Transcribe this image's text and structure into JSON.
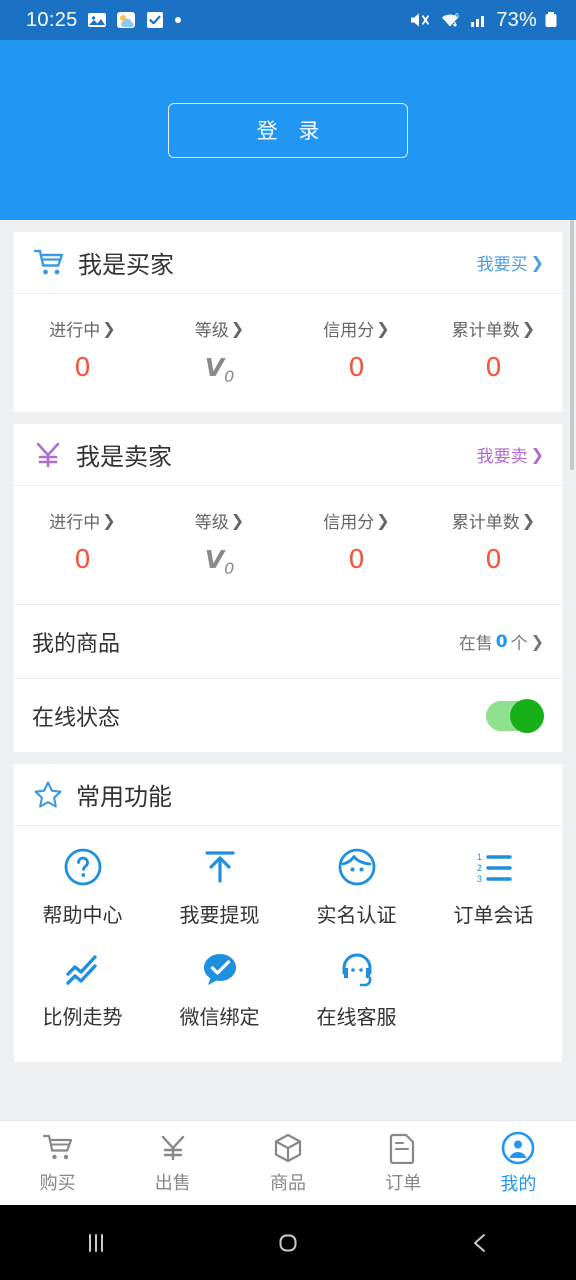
{
  "status_bar": {
    "time": "10:25",
    "left_icons": [
      "gallery-icon",
      "weather-icon",
      "task-icon",
      "dot-icon"
    ],
    "right_icons": [
      "mute-icon",
      "wifi-icon",
      "signal-icon"
    ],
    "battery": "73%",
    "background_color": "#1b72c4"
  },
  "header": {
    "login_label": "登 录",
    "background_color": "#2196f3"
  },
  "buyer_card": {
    "icon": "shopping-cart-icon",
    "title": "我是买家",
    "action_label": "我要买",
    "action_color": "#4a9fe0",
    "stats": [
      {
        "label": "进行中",
        "value": "0"
      },
      {
        "label": "等级",
        "value": "V0",
        "is_level": true
      },
      {
        "label": "信用分",
        "value": "0"
      },
      {
        "label": "累计单数",
        "value": "0"
      }
    ]
  },
  "seller_card": {
    "icon": "yen-icon",
    "title": "我是卖家",
    "action_label": "我要卖",
    "action_color": "#b06cd0",
    "stats": [
      {
        "label": "进行中",
        "value": "0"
      },
      {
        "label": "等级",
        "value": "V0",
        "is_level": true
      },
      {
        "label": "信用分",
        "value": "0"
      },
      {
        "label": "累计单数",
        "value": "0"
      }
    ],
    "goods_row": {
      "label": "我的商品",
      "value_prefix": "在售",
      "value_count": "0",
      "value_suffix": "个"
    },
    "online_row": {
      "label": "在线状态",
      "toggle_on": true,
      "toggle_color": "#18b018"
    }
  },
  "functions_card": {
    "icon": "star-icon",
    "title": "常用功能",
    "items": [
      {
        "icon": "question-circle-icon",
        "label": "帮助中心"
      },
      {
        "icon": "withdraw-arrow-icon",
        "label": "我要提现"
      },
      {
        "icon": "face-verify-icon",
        "label": "实名认证"
      },
      {
        "icon": "ordered-list-icon",
        "label": "订单会话"
      },
      {
        "icon": "trend-chart-icon",
        "label": "比例走势"
      },
      {
        "icon": "wechat-bind-icon",
        "label": "微信绑定"
      },
      {
        "icon": "headset-support-icon",
        "label": "在线客服"
      }
    ]
  },
  "tab_bar": {
    "items": [
      {
        "icon": "cart-icon",
        "label": "购买",
        "active": false
      },
      {
        "icon": "yen-icon",
        "label": "出售",
        "active": false
      },
      {
        "icon": "box-icon",
        "label": "商品",
        "active": false
      },
      {
        "icon": "document-icon",
        "label": "订单",
        "active": false
      },
      {
        "icon": "user-circle-icon",
        "label": "我的",
        "active": true
      }
    ],
    "active_color": "#2196f3",
    "inactive_color": "#888888"
  },
  "android_nav": {
    "buttons": [
      "recent-apps-icon",
      "home-icon",
      "back-icon"
    ]
  }
}
